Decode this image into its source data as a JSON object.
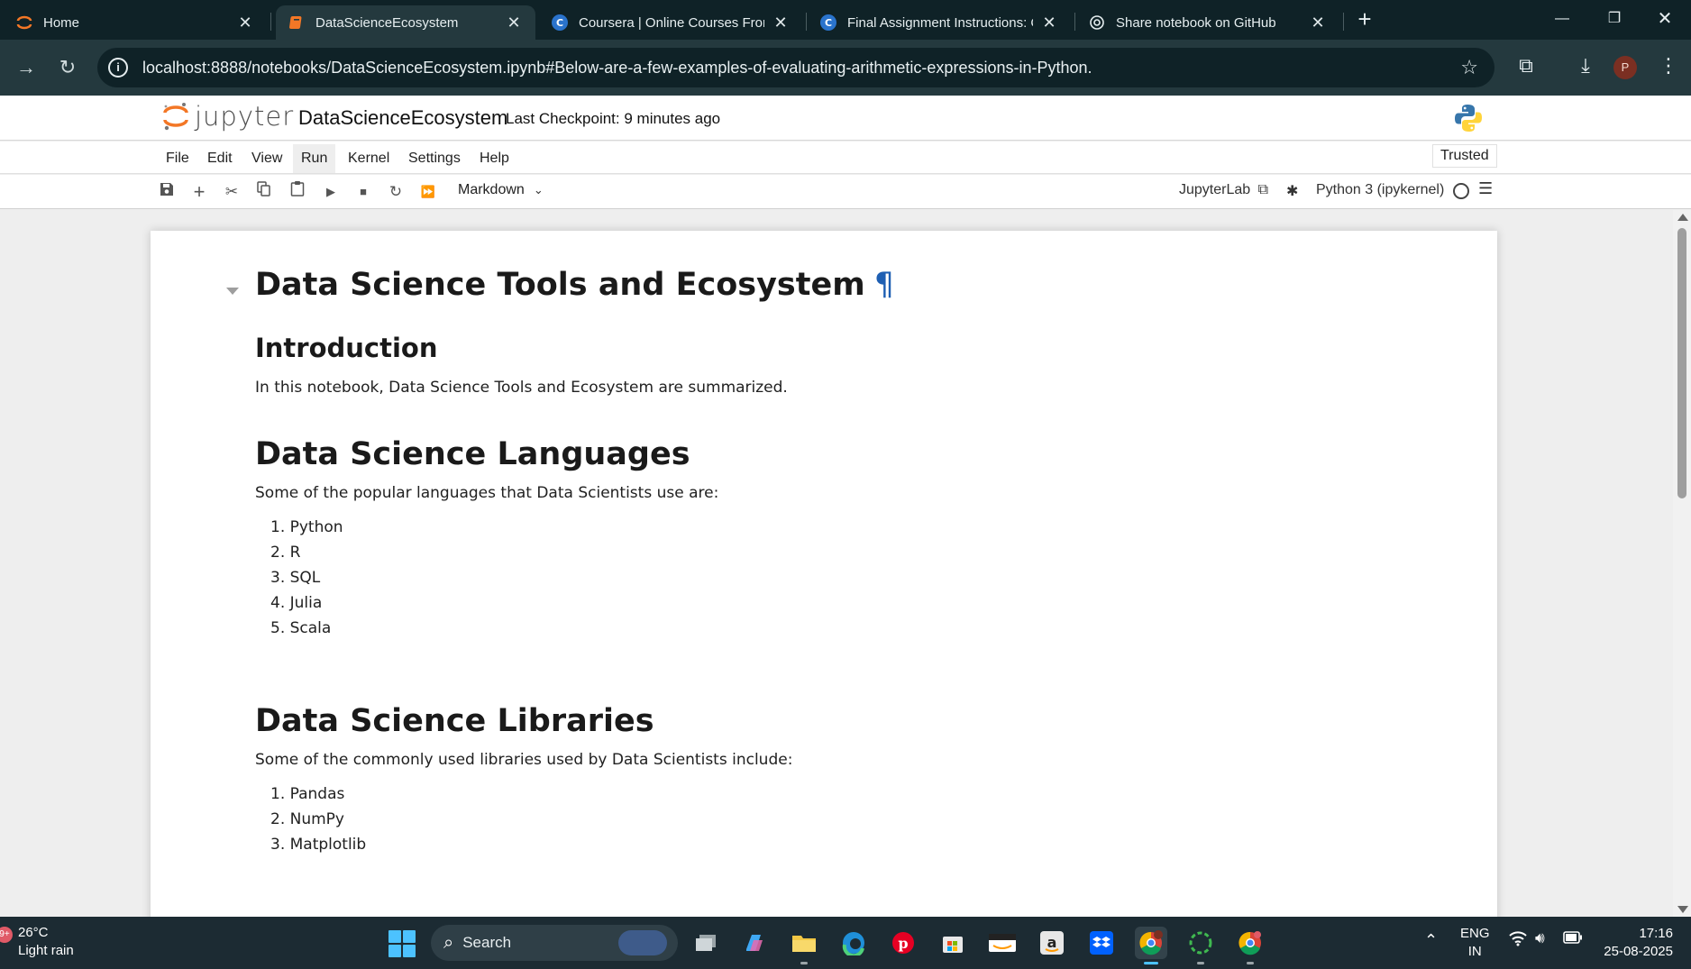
{
  "browser": {
    "tabs": [
      {
        "title": "Home",
        "active": false
      },
      {
        "title": "DataScienceEcosystem",
        "active": true
      },
      {
        "title": "Coursera | Online Courses From",
        "active": false
      },
      {
        "title": "Final Assignment Instructions: C",
        "active": false
      },
      {
        "title": "Share notebook on GitHub",
        "active": false
      }
    ],
    "url": "localhost:8888/notebooks/DataScienceEcosystem.ipynb#Below-are-a-few-examples-of-evaluating-arithmetic-expressions-in-Python.",
    "profile_initial": "P"
  },
  "jupyter": {
    "logo_text": "jupyter",
    "notebook_name": "DataScienceEcosystem",
    "checkpoint": "Last Checkpoint: 9 minutes ago",
    "menu": [
      "File",
      "Edit",
      "View",
      "Run",
      "Kernel",
      "Settings",
      "Help"
    ],
    "hovered_menu": "Run",
    "trusted_label": "Trusted",
    "cell_type": "Markdown",
    "jupyterlab_label": "JupyterLab",
    "kernel_name": "Python 3 (ipykernel)",
    "toolbar_icons": [
      "save-icon",
      "add-cell-icon",
      "cut-icon",
      "copy-icon",
      "paste-icon",
      "run-icon",
      "stop-icon",
      "restart-icon",
      "run-all-icon"
    ]
  },
  "notebook": {
    "title": "Data Science Tools and Ecosystem",
    "anchor": "¶",
    "intro_heading": "Introduction",
    "intro_text": "In this notebook, Data Science Tools and Ecosystem are summarized.",
    "languages_heading": "Data Science Languages",
    "languages_text": "Some of the popular languages that Data Scientists use are:",
    "languages": [
      "1. Python",
      "2. R",
      "3. SQL",
      "4. Julia",
      "5. Scala"
    ],
    "libraries_heading": "Data Science Libraries",
    "libraries_text": "Some of the commonly used libraries used by Data Scientists include:",
    "libraries": [
      "1. Pandas",
      "2. NumPy",
      "3. Matplotlib"
    ]
  },
  "taskbar": {
    "notification_badge": "9+",
    "temperature": "26°C",
    "weather": "Light rain",
    "search_label": "Search",
    "language": "ENG",
    "region": "IN",
    "time": "17:16",
    "date": "25-08-2025"
  },
  "colors": {
    "jupyter_orange": "#f37726",
    "anchor_blue": "#1e5fb3",
    "browser_dark": "#0f2227",
    "browser_toolbar": "#24393e",
    "taskbar": "#1c2b33"
  }
}
